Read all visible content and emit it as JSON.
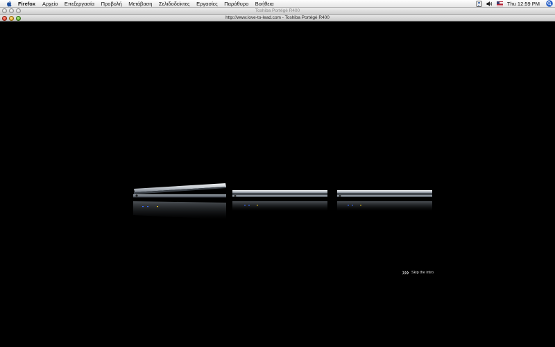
{
  "menubar": {
    "apple_icon": "apple-logo-icon",
    "app_name": "Firefox",
    "items": [
      "Αρχείο",
      "Επεξεργασία",
      "Προβολή",
      "Μετάβαση",
      "Σελιδοδείκτες",
      "Εργασίες",
      "Παράθυρο",
      "Βοήθεια"
    ],
    "status_icons": [
      "script-menu-icon",
      "volume-icon",
      "us-flag-input-icon"
    ],
    "clock": "Thu 12:59 PM",
    "spotlight_icon": "spotlight-search-icon"
  },
  "window": {
    "title": "Toshiba Portégé R400",
    "page_title": "http://www.love-to-lead.com - Toshiba Portégé R400"
  },
  "page": {
    "skip_label": "Skip the intro",
    "skip_icon": "triple-chevron-right-icon",
    "background": "#000000"
  }
}
